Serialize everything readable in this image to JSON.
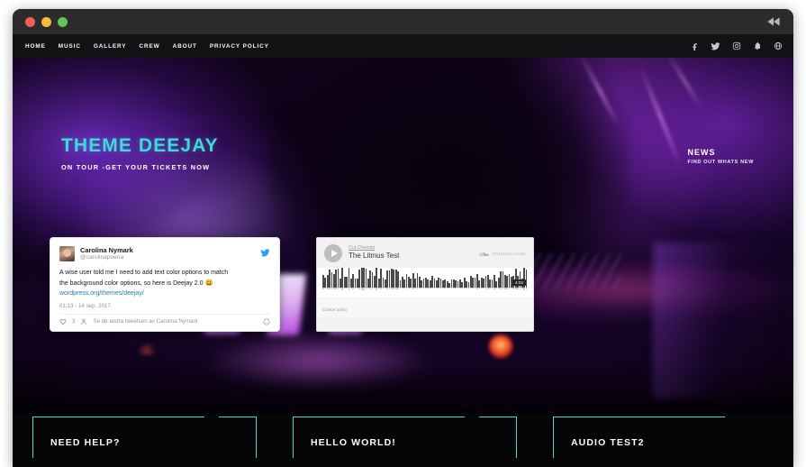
{
  "window": {
    "traffic_lights": [
      "close",
      "minimize",
      "maximize"
    ],
    "titlebar_icon": "rewind-icon"
  },
  "nav": {
    "links": [
      {
        "label": "HOME"
      },
      {
        "label": "MUSIC"
      },
      {
        "label": "GALLERY"
      },
      {
        "label": "CREW"
      },
      {
        "label": "ABOUT"
      },
      {
        "label": "PRIVACY POLICY"
      }
    ],
    "social": [
      {
        "name": "facebook-icon"
      },
      {
        "name": "twitter-icon"
      },
      {
        "name": "instagram-icon"
      },
      {
        "name": "bell-icon"
      },
      {
        "name": "globe-icon"
      }
    ]
  },
  "hero": {
    "title": "THEME DEEJAY",
    "subtitle": "ON TOUR -GET YOUR TICKETS NOW",
    "news_title": "NEWS",
    "news_subtitle": "FIND OUT WHATS NEW",
    "accent_color": "#3ed9d9"
  },
  "twitter_card": {
    "display_name": "Carolina Nymark",
    "handle": "@carolinapoena",
    "body_line1": "A wise user told me I need to add text color options to match",
    "body_line2": "the background color options, so here is Deejay 2.0",
    "emoji": "😃",
    "link": "wordpress.org/themes/deejay/",
    "timestamp": "01:13 - 14 sep. 2017",
    "like_count": "3",
    "footer_text": "Se de andra tweetsen av Carolina Nymark",
    "brand_color": "#1da1f2"
  },
  "soundcloud_card": {
    "artist": "Cut Chemist",
    "track": "The Litmus Test",
    "brand": "SOUNDCLOUD",
    "duration": "4:03",
    "cookie_policy": "Cookie policy",
    "play_label": "play-button"
  },
  "widgets": [
    {
      "title": "NEED HELP?"
    },
    {
      "title": "HELLO WORLD!"
    },
    {
      "title": "AUDIO TEST2"
    }
  ]
}
